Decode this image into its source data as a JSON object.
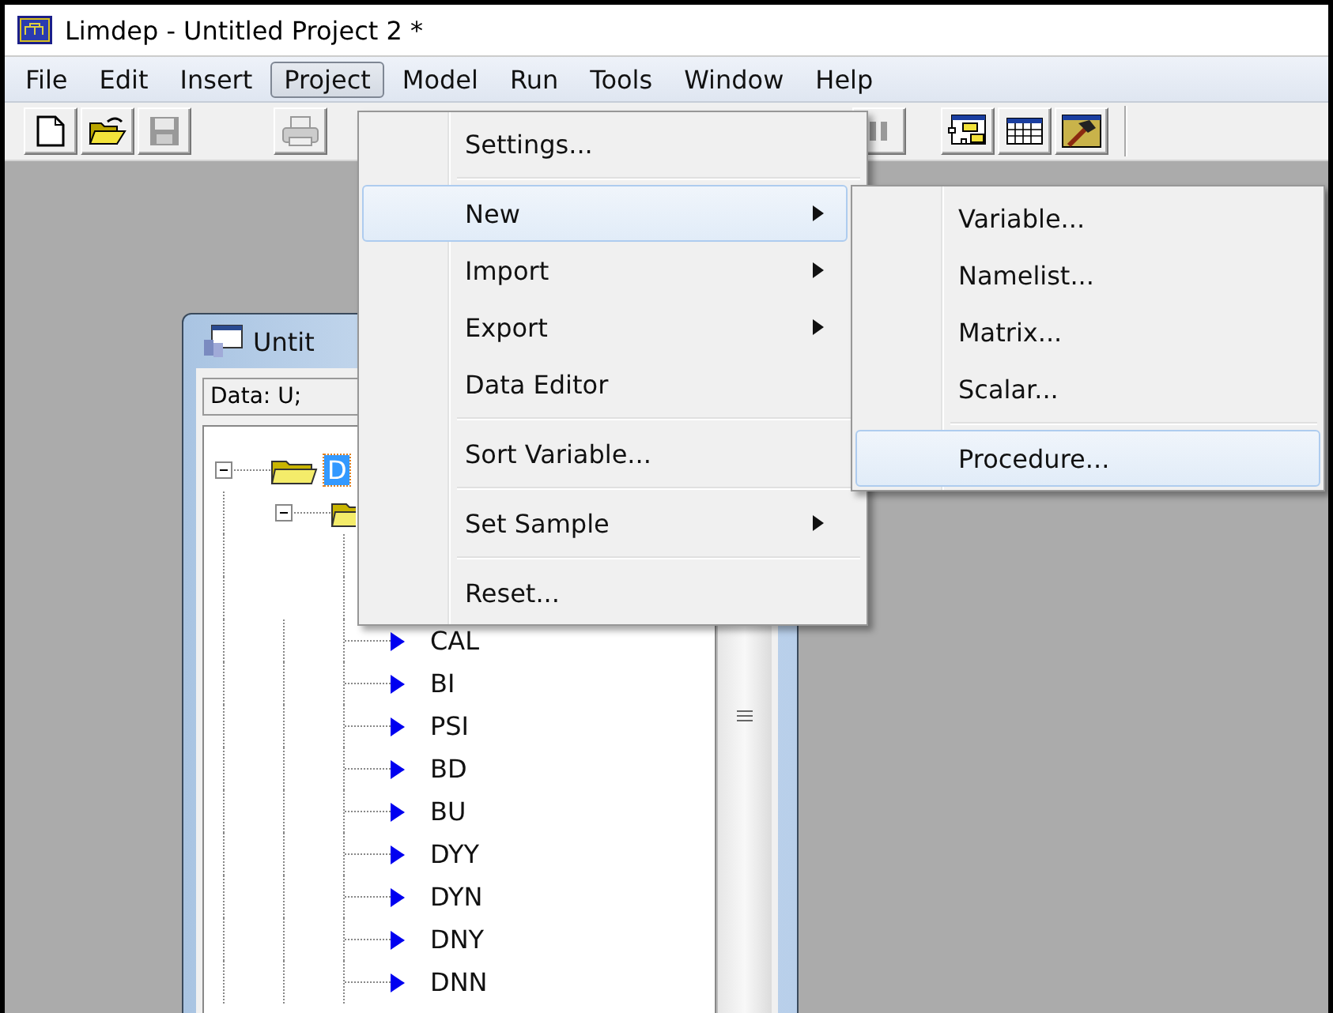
{
  "window": {
    "title": "Limdep - Untitled Project 2 *"
  },
  "menu_bar": [
    {
      "label": "File",
      "selected": false
    },
    {
      "label": "Edit",
      "selected": false
    },
    {
      "label": "Insert",
      "selected": false
    },
    {
      "label": "Project",
      "selected": true
    },
    {
      "label": "Model",
      "selected": false
    },
    {
      "label": "Run",
      "selected": false
    },
    {
      "label": "Tools",
      "selected": false
    },
    {
      "label": "Window",
      "selected": false
    },
    {
      "label": "Help",
      "selected": false
    }
  ],
  "toolbar": [
    [
      {
        "kind": "new",
        "disabled": false
      },
      {
        "kind": "open",
        "disabled": false
      },
      {
        "kind": "save",
        "disabled": true
      }
    ],
    [
      {
        "kind": "print",
        "disabled": true
      }
    ],
    [
      {
        "kind": "pause",
        "disabled": true
      }
    ],
    [
      {
        "kind": "project",
        "disabled": false
      },
      {
        "kind": "grid",
        "disabled": false
      },
      {
        "kind": "hammer",
        "disabled": false
      }
    ]
  ],
  "project_menu": [
    {
      "kind": "item",
      "label": "Settings...",
      "selected": false,
      "has_submenu": false
    },
    {
      "kind": "separator"
    },
    {
      "kind": "item",
      "label": "New",
      "selected": true,
      "has_submenu": true
    },
    {
      "kind": "item",
      "label": "Import",
      "selected": false,
      "has_submenu": true
    },
    {
      "kind": "item",
      "label": "Export",
      "selected": false,
      "has_submenu": true
    },
    {
      "kind": "item",
      "label": "Data Editor",
      "selected": false,
      "has_submenu": false
    },
    {
      "kind": "separator"
    },
    {
      "kind": "item",
      "label": "Sort Variable...",
      "selected": false,
      "has_submenu": false
    },
    {
      "kind": "separator"
    },
    {
      "kind": "item",
      "label": "Set Sample",
      "selected": false,
      "has_submenu": true
    },
    {
      "kind": "separator"
    },
    {
      "kind": "item",
      "label": "Reset...",
      "selected": false,
      "has_submenu": false
    }
  ],
  "new_submenu": [
    {
      "kind": "item",
      "label": "Variable...",
      "selected": false
    },
    {
      "kind": "item",
      "label": "Namelist...",
      "selected": false
    },
    {
      "kind": "item",
      "label": "Matrix...",
      "selected": false
    },
    {
      "kind": "item",
      "label": "Scalar...",
      "selected": false
    },
    {
      "kind": "separator"
    },
    {
      "kind": "item",
      "label": "Procedure...",
      "selected": true
    }
  ],
  "project_window": {
    "title": "Untit",
    "data_field": "Data: U;",
    "tree": [
      {
        "kind": "folder",
        "label": "D",
        "selected": true,
        "expanded": true,
        "children": [
          {
            "kind": "folder",
            "selected": false,
            "expanded": true,
            "children": [
              {
                "kind": "variable",
                "label": "CAL",
                "selected": false
              },
              {
                "kind": "variable",
                "label": "BI",
                "selected": false
              },
              {
                "kind": "variable",
                "label": "PSI",
                "selected": false
              },
              {
                "kind": "variable",
                "label": "BD",
                "selected": false
              },
              {
                "kind": "variable",
                "label": "BU",
                "selected": false
              },
              {
                "kind": "variable",
                "label": "DYY",
                "selected": false
              },
              {
                "kind": "variable",
                "label": "DYN",
                "selected": false
              },
              {
                "kind": "variable",
                "label": "DNY",
                "selected": false
              },
              {
                "kind": "variable",
                "label": "DNN",
                "selected": false
              }
            ]
          }
        ]
      }
    ]
  }
}
